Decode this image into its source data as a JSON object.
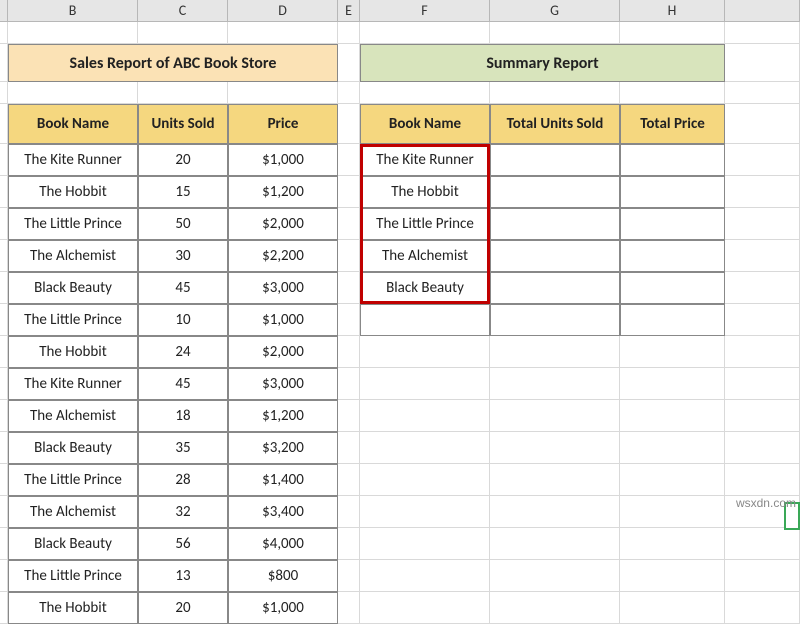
{
  "columns": [
    "B",
    "C",
    "D",
    "E",
    "F",
    "G",
    "H"
  ],
  "titles": {
    "sales": "Sales Report of ABC Book Store",
    "summary": "Summary Report"
  },
  "sales_headers": {
    "b": "Book Name",
    "c": "Units Sold",
    "d": "Price"
  },
  "summary_headers": {
    "f": "Book Name",
    "g": "Total Units Sold",
    "h": "Total Price"
  },
  "sales_rows": [
    {
      "name": "The Kite Runner",
      "units": "20",
      "price": "$1,000"
    },
    {
      "name": "The Hobbit",
      "units": "15",
      "price": "$1,200"
    },
    {
      "name": "The Little Prince",
      "units": "50",
      "price": "$2,000"
    },
    {
      "name": "The Alchemist",
      "units": "30",
      "price": "$2,200"
    },
    {
      "name": "Black Beauty",
      "units": "45",
      "price": "$3,000"
    },
    {
      "name": "The Little Prince",
      "units": "10",
      "price": "$1,000"
    },
    {
      "name": "The Hobbit",
      "units": "24",
      "price": "$2,000"
    },
    {
      "name": "The Kite Runner",
      "units": "45",
      "price": "$3,000"
    },
    {
      "name": "The Alchemist",
      "units": "18",
      "price": "$1,200"
    },
    {
      "name": "Black Beauty",
      "units": "35",
      "price": "$3,200"
    },
    {
      "name": "The Little Prince",
      "units": "28",
      "price": "$1,400"
    },
    {
      "name": "The Alchemist",
      "units": "32",
      "price": "$3,400"
    },
    {
      "name": "Black Beauty",
      "units": "56",
      "price": "$4,000"
    },
    {
      "name": "The Little Prince",
      "units": "13",
      "price": "$800"
    },
    {
      "name": "The Hobbit",
      "units": "20",
      "price": "$1,000"
    }
  ],
  "summary_rows": [
    {
      "name": "The Kite Runner"
    },
    {
      "name": "The Hobbit"
    },
    {
      "name": "The Little Prince"
    },
    {
      "name": "The Alchemist"
    },
    {
      "name": "Black Beauty"
    }
  ],
  "watermark": "wsxdn.com"
}
